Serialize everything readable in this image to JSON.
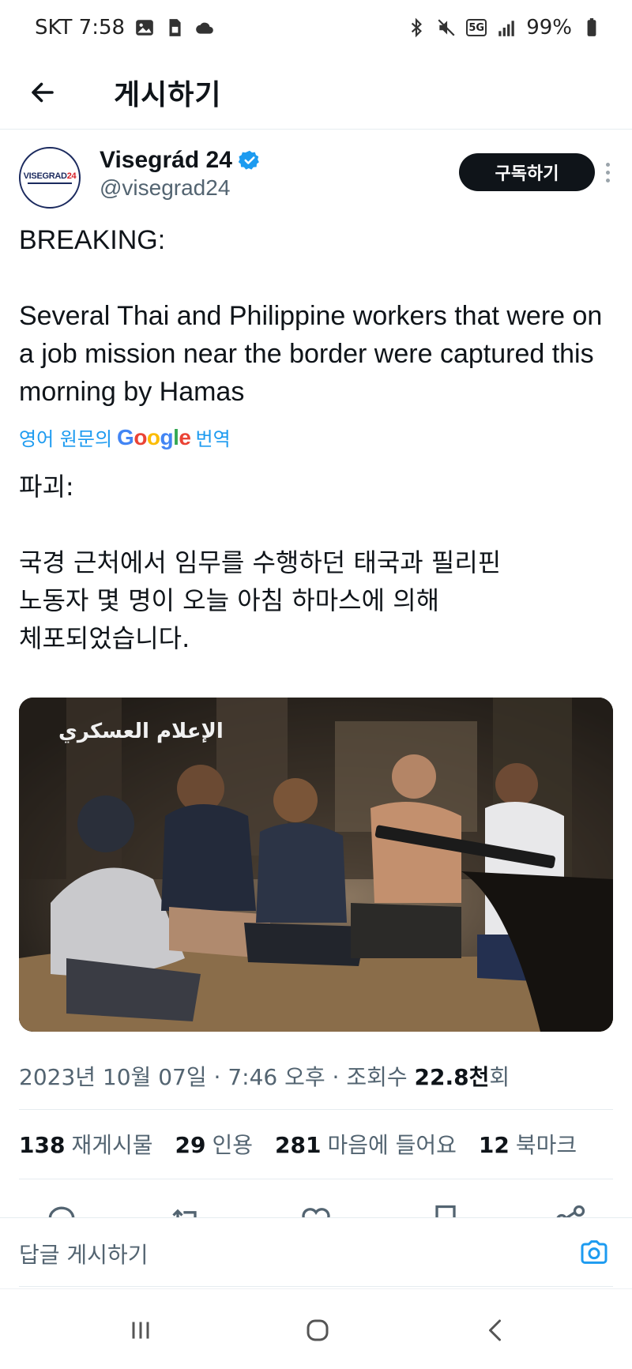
{
  "status_bar": {
    "carrier_time": "SKT 7:58",
    "network_badge": "5G",
    "battery": "99%",
    "icons_left": [
      "gallery-icon",
      "sim-icon",
      "cloud-icon"
    ],
    "icons_right": [
      "bluetooth-icon",
      "mute-icon",
      "5g-icon",
      "signal-icon",
      "battery-icon"
    ]
  },
  "header": {
    "title": "게시하기"
  },
  "tweet": {
    "author": {
      "display_name": "Visegrád 24",
      "handle": "@visegrad24",
      "avatar_text_main": "VISEGRAD",
      "avatar_text_accent": "24"
    },
    "subscribe_label": "구독하기",
    "text_heading": "BREAKING:",
    "text_body": "Several Thai and Philippine workers that were on a job mission near the border were captured this morning by Hamas",
    "translate": {
      "prefix": "영어 원문의",
      "suffix": "번역"
    },
    "translated_heading": "파괴:",
    "translated_line1": "국경 근처에서 임무를 수행하던 태국과 필리핀",
    "translated_line2": "노동자 몇 명이 오늘 아침 하마스에 의해",
    "translated_line3": "체포되었습니다.",
    "media_watermark": "الإعلام العسكري",
    "meta": {
      "date": "2023년 10월 07일",
      "time": "7:46 오후",
      "views_label": "조회수",
      "views_count": "22.8천",
      "views_suffix": "회"
    },
    "stats": {
      "retweets_count": "138",
      "retweets_label": "재게시물",
      "quotes_count": "29",
      "quotes_label": "인용",
      "likes_count": "281",
      "likes_label": "마음에 들어요",
      "bookmarks_count": "12",
      "bookmarks_label": "북마크"
    }
  },
  "reply_bar": {
    "placeholder": "답글 게시하기"
  },
  "colors": {
    "accent": "#1d9bf0",
    "text_primary": "#0f1419",
    "text_secondary": "#536471",
    "subscribe_bg": "#0f1419"
  }
}
